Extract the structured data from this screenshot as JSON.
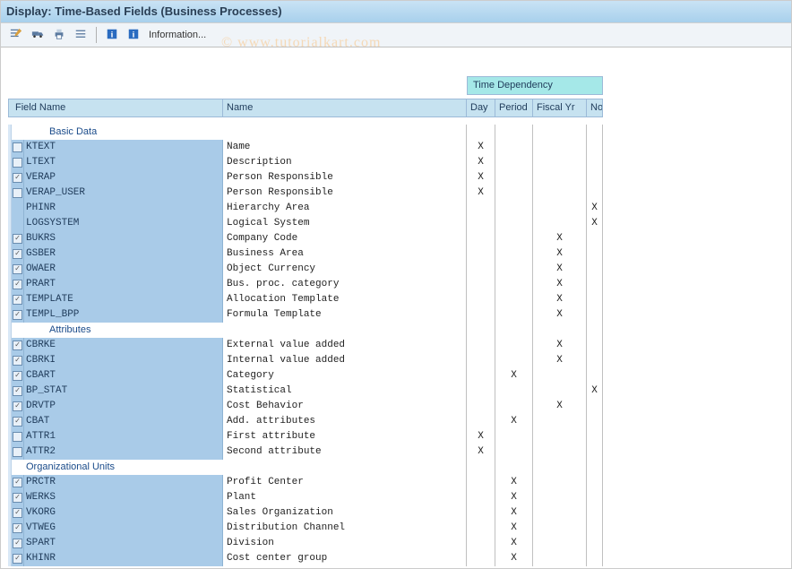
{
  "title": "Display: Time-Based Fields (Business Processes)",
  "toolbar": {
    "info_label": "Information..."
  },
  "watermark": "© www.tutorialkart.com",
  "headers": {
    "time_dependency": "Time Dependency",
    "field_name": "Field Name",
    "name": "Name",
    "day": "Day",
    "period": "Period",
    "fiscal_yr": "Fiscal Yr",
    "no": "No"
  },
  "sections": [
    {
      "label": "Basic Data",
      "indent": true,
      "rows": [
        {
          "cb": false,
          "cbshown": true,
          "field": "KTEXT",
          "name": "Name",
          "day": "X",
          "period": "",
          "fiscal": "",
          "no": ""
        },
        {
          "cb": false,
          "cbshown": true,
          "field": "LTEXT",
          "name": "Description",
          "day": "X",
          "period": "",
          "fiscal": "",
          "no": ""
        },
        {
          "cb": true,
          "cbshown": true,
          "field": "VERAP",
          "name": "Person Responsible",
          "day": "X",
          "period": "",
          "fiscal": "",
          "no": ""
        },
        {
          "cb": false,
          "cbshown": true,
          "field": "VERAP_USER",
          "name": "Person Responsible",
          "day": "X",
          "period": "",
          "fiscal": "",
          "no": ""
        },
        {
          "cb": false,
          "cbshown": false,
          "field": " PHINR",
          "name": "Hierarchy Area",
          "day": "",
          "period": "",
          "fiscal": "",
          "no": "X"
        },
        {
          "cb": false,
          "cbshown": false,
          "field": " LOGSYSTEM",
          "name": "Logical System",
          "day": "",
          "period": "",
          "fiscal": "",
          "no": "X"
        },
        {
          "cb": true,
          "cbshown": true,
          "field": "BUKRS",
          "name": "Company Code",
          "day": "",
          "period": "",
          "fiscal": "X",
          "no": ""
        },
        {
          "cb": true,
          "cbshown": true,
          "field": "GSBER",
          "name": "Business Area",
          "day": "",
          "period": "",
          "fiscal": "X",
          "no": ""
        },
        {
          "cb": true,
          "cbshown": true,
          "field": "OWAER",
          "name": "Object Currency",
          "day": "",
          "period": "",
          "fiscal": "X",
          "no": ""
        },
        {
          "cb": true,
          "cbshown": true,
          "field": "PRART",
          "name": "Bus. proc. category",
          "day": "",
          "period": "",
          "fiscal": "X",
          "no": ""
        },
        {
          "cb": true,
          "cbshown": true,
          "field": "TEMPLATE",
          "name": "Allocation Template",
          "day": "",
          "period": "",
          "fiscal": "X",
          "no": ""
        },
        {
          "cb": true,
          "cbshown": true,
          "field": "TEMPL_BPP",
          "name": "Formula Template",
          "day": "",
          "period": "",
          "fiscal": "X",
          "no": ""
        }
      ]
    },
    {
      "label": "Attributes",
      "indent": true,
      "rows": [
        {
          "cb": true,
          "cbshown": true,
          "field": "CBRKE",
          "name": "External value added",
          "day": "",
          "period": "",
          "fiscal": "X",
          "no": ""
        },
        {
          "cb": true,
          "cbshown": true,
          "field": "CBRKI",
          "name": "Internal value added",
          "day": "",
          "period": "",
          "fiscal": "X",
          "no": ""
        },
        {
          "cb": true,
          "cbshown": true,
          "field": "CBART",
          "name": "Category",
          "day": "",
          "period": "X",
          "fiscal": "",
          "no": ""
        },
        {
          "cb": true,
          "cbshown": true,
          "field": "BP_STAT",
          "name": "Statistical",
          "day": "",
          "period": "",
          "fiscal": "",
          "no": "X"
        },
        {
          "cb": true,
          "cbshown": true,
          "field": "DRVTP",
          "name": "Cost Behavior",
          "day": "",
          "period": "",
          "fiscal": "X",
          "no": ""
        },
        {
          "cb": true,
          "cbshown": true,
          "field": "CBAT",
          "name": "Add. attributes",
          "day": "",
          "period": "X",
          "fiscal": "",
          "no": ""
        },
        {
          "cb": false,
          "cbshown": true,
          "field": "ATTR1",
          "name": "First attribute",
          "day": "X",
          "period": "",
          "fiscal": "",
          "no": ""
        },
        {
          "cb": false,
          "cbshown": true,
          "field": "ATTR2",
          "name": "Second attribute",
          "day": "X",
          "period": "",
          "fiscal": "",
          "no": ""
        }
      ]
    },
    {
      "label": "Organizational Units",
      "indent": false,
      "rows": [
        {
          "cb": true,
          "cbshown": true,
          "field": "PRCTR",
          "name": "Profit Center",
          "day": "",
          "period": "X",
          "fiscal": "",
          "no": ""
        },
        {
          "cb": true,
          "cbshown": true,
          "field": "WERKS",
          "name": "Plant",
          "day": "",
          "period": "X",
          "fiscal": "",
          "no": ""
        },
        {
          "cb": true,
          "cbshown": true,
          "field": "VKORG",
          "name": "Sales Organization",
          "day": "",
          "period": "X",
          "fiscal": "",
          "no": ""
        },
        {
          "cb": true,
          "cbshown": true,
          "field": "VTWEG",
          "name": "Distribution Channel",
          "day": "",
          "period": "X",
          "fiscal": "",
          "no": ""
        },
        {
          "cb": true,
          "cbshown": true,
          "field": "SPART",
          "name": "Division",
          "day": "",
          "period": "X",
          "fiscal": "",
          "no": ""
        },
        {
          "cb": true,
          "cbshown": true,
          "field": "KHINR",
          "name": "Cost center group",
          "day": "",
          "period": "X",
          "fiscal": "",
          "no": ""
        }
      ]
    }
  ]
}
